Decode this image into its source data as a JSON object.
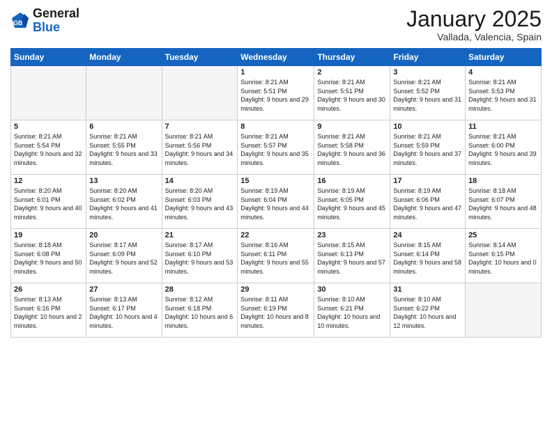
{
  "header": {
    "logo_line1": "General",
    "logo_line2": "Blue",
    "month": "January 2025",
    "location": "Vallada, Valencia, Spain"
  },
  "days_of_week": [
    "Sunday",
    "Monday",
    "Tuesday",
    "Wednesday",
    "Thursday",
    "Friday",
    "Saturday"
  ],
  "weeks": [
    [
      {
        "day": "",
        "info": ""
      },
      {
        "day": "",
        "info": ""
      },
      {
        "day": "",
        "info": ""
      },
      {
        "day": "1",
        "info": "Sunrise: 8:21 AM\nSunset: 5:51 PM\nDaylight: 9 hours and 29 minutes."
      },
      {
        "day": "2",
        "info": "Sunrise: 8:21 AM\nSunset: 5:51 PM\nDaylight: 9 hours and 30 minutes."
      },
      {
        "day": "3",
        "info": "Sunrise: 8:21 AM\nSunset: 5:52 PM\nDaylight: 9 hours and 31 minutes."
      },
      {
        "day": "4",
        "info": "Sunrise: 8:21 AM\nSunset: 5:53 PM\nDaylight: 9 hours and 31 minutes."
      }
    ],
    [
      {
        "day": "5",
        "info": "Sunrise: 8:21 AM\nSunset: 5:54 PM\nDaylight: 9 hours and 32 minutes."
      },
      {
        "day": "6",
        "info": "Sunrise: 8:21 AM\nSunset: 5:55 PM\nDaylight: 9 hours and 33 minutes."
      },
      {
        "day": "7",
        "info": "Sunrise: 8:21 AM\nSunset: 5:56 PM\nDaylight: 9 hours and 34 minutes."
      },
      {
        "day": "8",
        "info": "Sunrise: 8:21 AM\nSunset: 5:57 PM\nDaylight: 9 hours and 35 minutes."
      },
      {
        "day": "9",
        "info": "Sunrise: 8:21 AM\nSunset: 5:58 PM\nDaylight: 9 hours and 36 minutes."
      },
      {
        "day": "10",
        "info": "Sunrise: 8:21 AM\nSunset: 5:59 PM\nDaylight: 9 hours and 37 minutes."
      },
      {
        "day": "11",
        "info": "Sunrise: 8:21 AM\nSunset: 6:00 PM\nDaylight: 9 hours and 39 minutes."
      }
    ],
    [
      {
        "day": "12",
        "info": "Sunrise: 8:20 AM\nSunset: 6:01 PM\nDaylight: 9 hours and 40 minutes."
      },
      {
        "day": "13",
        "info": "Sunrise: 8:20 AM\nSunset: 6:02 PM\nDaylight: 9 hours and 41 minutes."
      },
      {
        "day": "14",
        "info": "Sunrise: 8:20 AM\nSunset: 6:03 PM\nDaylight: 9 hours and 43 minutes."
      },
      {
        "day": "15",
        "info": "Sunrise: 8:19 AM\nSunset: 6:04 PM\nDaylight: 9 hours and 44 minutes."
      },
      {
        "day": "16",
        "info": "Sunrise: 8:19 AM\nSunset: 6:05 PM\nDaylight: 9 hours and 45 minutes."
      },
      {
        "day": "17",
        "info": "Sunrise: 8:19 AM\nSunset: 6:06 PM\nDaylight: 9 hours and 47 minutes."
      },
      {
        "day": "18",
        "info": "Sunrise: 8:18 AM\nSunset: 6:07 PM\nDaylight: 9 hours and 48 minutes."
      }
    ],
    [
      {
        "day": "19",
        "info": "Sunrise: 8:18 AM\nSunset: 6:08 PM\nDaylight: 9 hours and 50 minutes."
      },
      {
        "day": "20",
        "info": "Sunrise: 8:17 AM\nSunset: 6:09 PM\nDaylight: 9 hours and 52 minutes."
      },
      {
        "day": "21",
        "info": "Sunrise: 8:17 AM\nSunset: 6:10 PM\nDaylight: 9 hours and 53 minutes."
      },
      {
        "day": "22",
        "info": "Sunrise: 8:16 AM\nSunset: 6:11 PM\nDaylight: 9 hours and 55 minutes."
      },
      {
        "day": "23",
        "info": "Sunrise: 8:15 AM\nSunset: 6:13 PM\nDaylight: 9 hours and 57 minutes."
      },
      {
        "day": "24",
        "info": "Sunrise: 8:15 AM\nSunset: 6:14 PM\nDaylight: 9 hours and 58 minutes."
      },
      {
        "day": "25",
        "info": "Sunrise: 8:14 AM\nSunset: 6:15 PM\nDaylight: 10 hours and 0 minutes."
      }
    ],
    [
      {
        "day": "26",
        "info": "Sunrise: 8:13 AM\nSunset: 6:16 PM\nDaylight: 10 hours and 2 minutes."
      },
      {
        "day": "27",
        "info": "Sunrise: 8:13 AM\nSunset: 6:17 PM\nDaylight: 10 hours and 4 minutes."
      },
      {
        "day": "28",
        "info": "Sunrise: 8:12 AM\nSunset: 6:18 PM\nDaylight: 10 hours and 6 minutes."
      },
      {
        "day": "29",
        "info": "Sunrise: 8:11 AM\nSunset: 6:19 PM\nDaylight: 10 hours and 8 minutes."
      },
      {
        "day": "30",
        "info": "Sunrise: 8:10 AM\nSunset: 6:21 PM\nDaylight: 10 hours and 10 minutes."
      },
      {
        "day": "31",
        "info": "Sunrise: 8:10 AM\nSunset: 6:22 PM\nDaylight: 10 hours and 12 minutes."
      },
      {
        "day": "",
        "info": ""
      }
    ]
  ]
}
